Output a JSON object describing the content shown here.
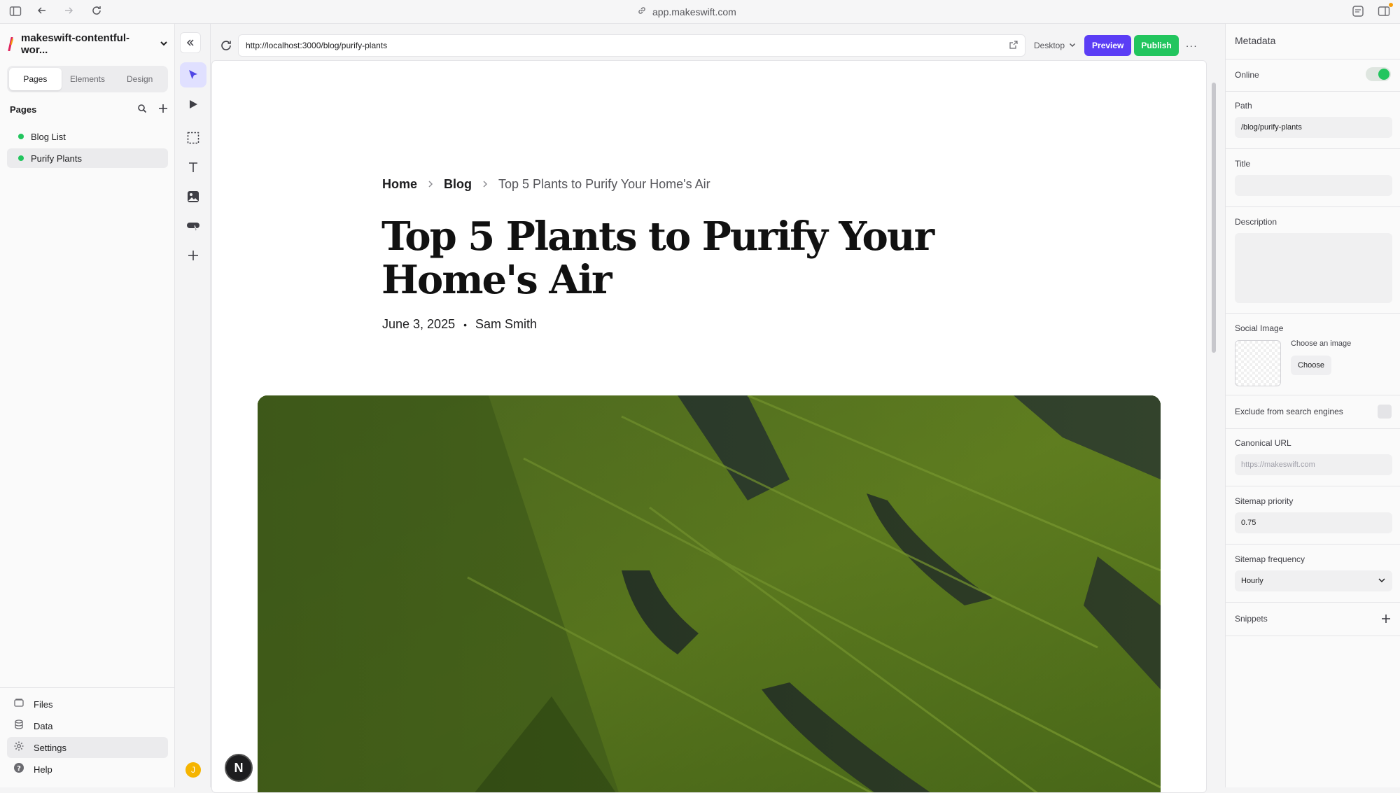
{
  "browser": {
    "address": "app.makeswift.com"
  },
  "sidebar": {
    "project_name": "makeswift-contentful-wor...",
    "tabs": [
      {
        "label": "Pages",
        "active": true
      },
      {
        "label": "Elements",
        "active": false
      },
      {
        "label": "Design",
        "active": false
      }
    ],
    "pages_header": "Pages",
    "pages": [
      {
        "label": "Blog List",
        "active": false
      },
      {
        "label": "Purify Plants",
        "active": true
      }
    ],
    "bottom_nav": [
      {
        "label": "Files",
        "icon": "files-icon"
      },
      {
        "label": "Data",
        "icon": "database-icon"
      },
      {
        "label": "Settings",
        "icon": "gear-icon"
      },
      {
        "label": "Help",
        "icon": "help-icon"
      }
    ]
  },
  "rail": {
    "avatar_initial": "J"
  },
  "canvas": {
    "url": "http://localhost:3000/blog/purify-plants",
    "device": "Desktop",
    "preview_label": "Preview",
    "publish_label": "Publish",
    "more_label": "···",
    "breadcrumb": {
      "home": "Home",
      "blog": "Blog",
      "current": "Top 5 Plants to Purify Your Home's Air"
    },
    "article_title": "Top 5 Plants to Purify Your Home's Air",
    "date": "June 3, 2025",
    "bullet": "•",
    "author": "Sam Smith",
    "next_badge": "N"
  },
  "metadata": {
    "title": "Metadata",
    "online_label": "Online",
    "online": true,
    "path_label": "Path",
    "path_value": "/blog/purify-plants",
    "title_label": "Title",
    "title_value": "",
    "description_label": "Description",
    "description_value": "",
    "social_image_label": "Social Image",
    "choose_image_text": "Choose an image",
    "choose_button": "Choose",
    "exclude_label": "Exclude from search engines",
    "canonical_label": "Canonical URL",
    "canonical_placeholder": "https://makeswift.com",
    "sitemap_priority_label": "Sitemap priority",
    "sitemap_priority_value": "0.75",
    "sitemap_frequency_label": "Sitemap frequency",
    "sitemap_frequency_value": "Hourly",
    "snippets_label": "Snippets"
  }
}
